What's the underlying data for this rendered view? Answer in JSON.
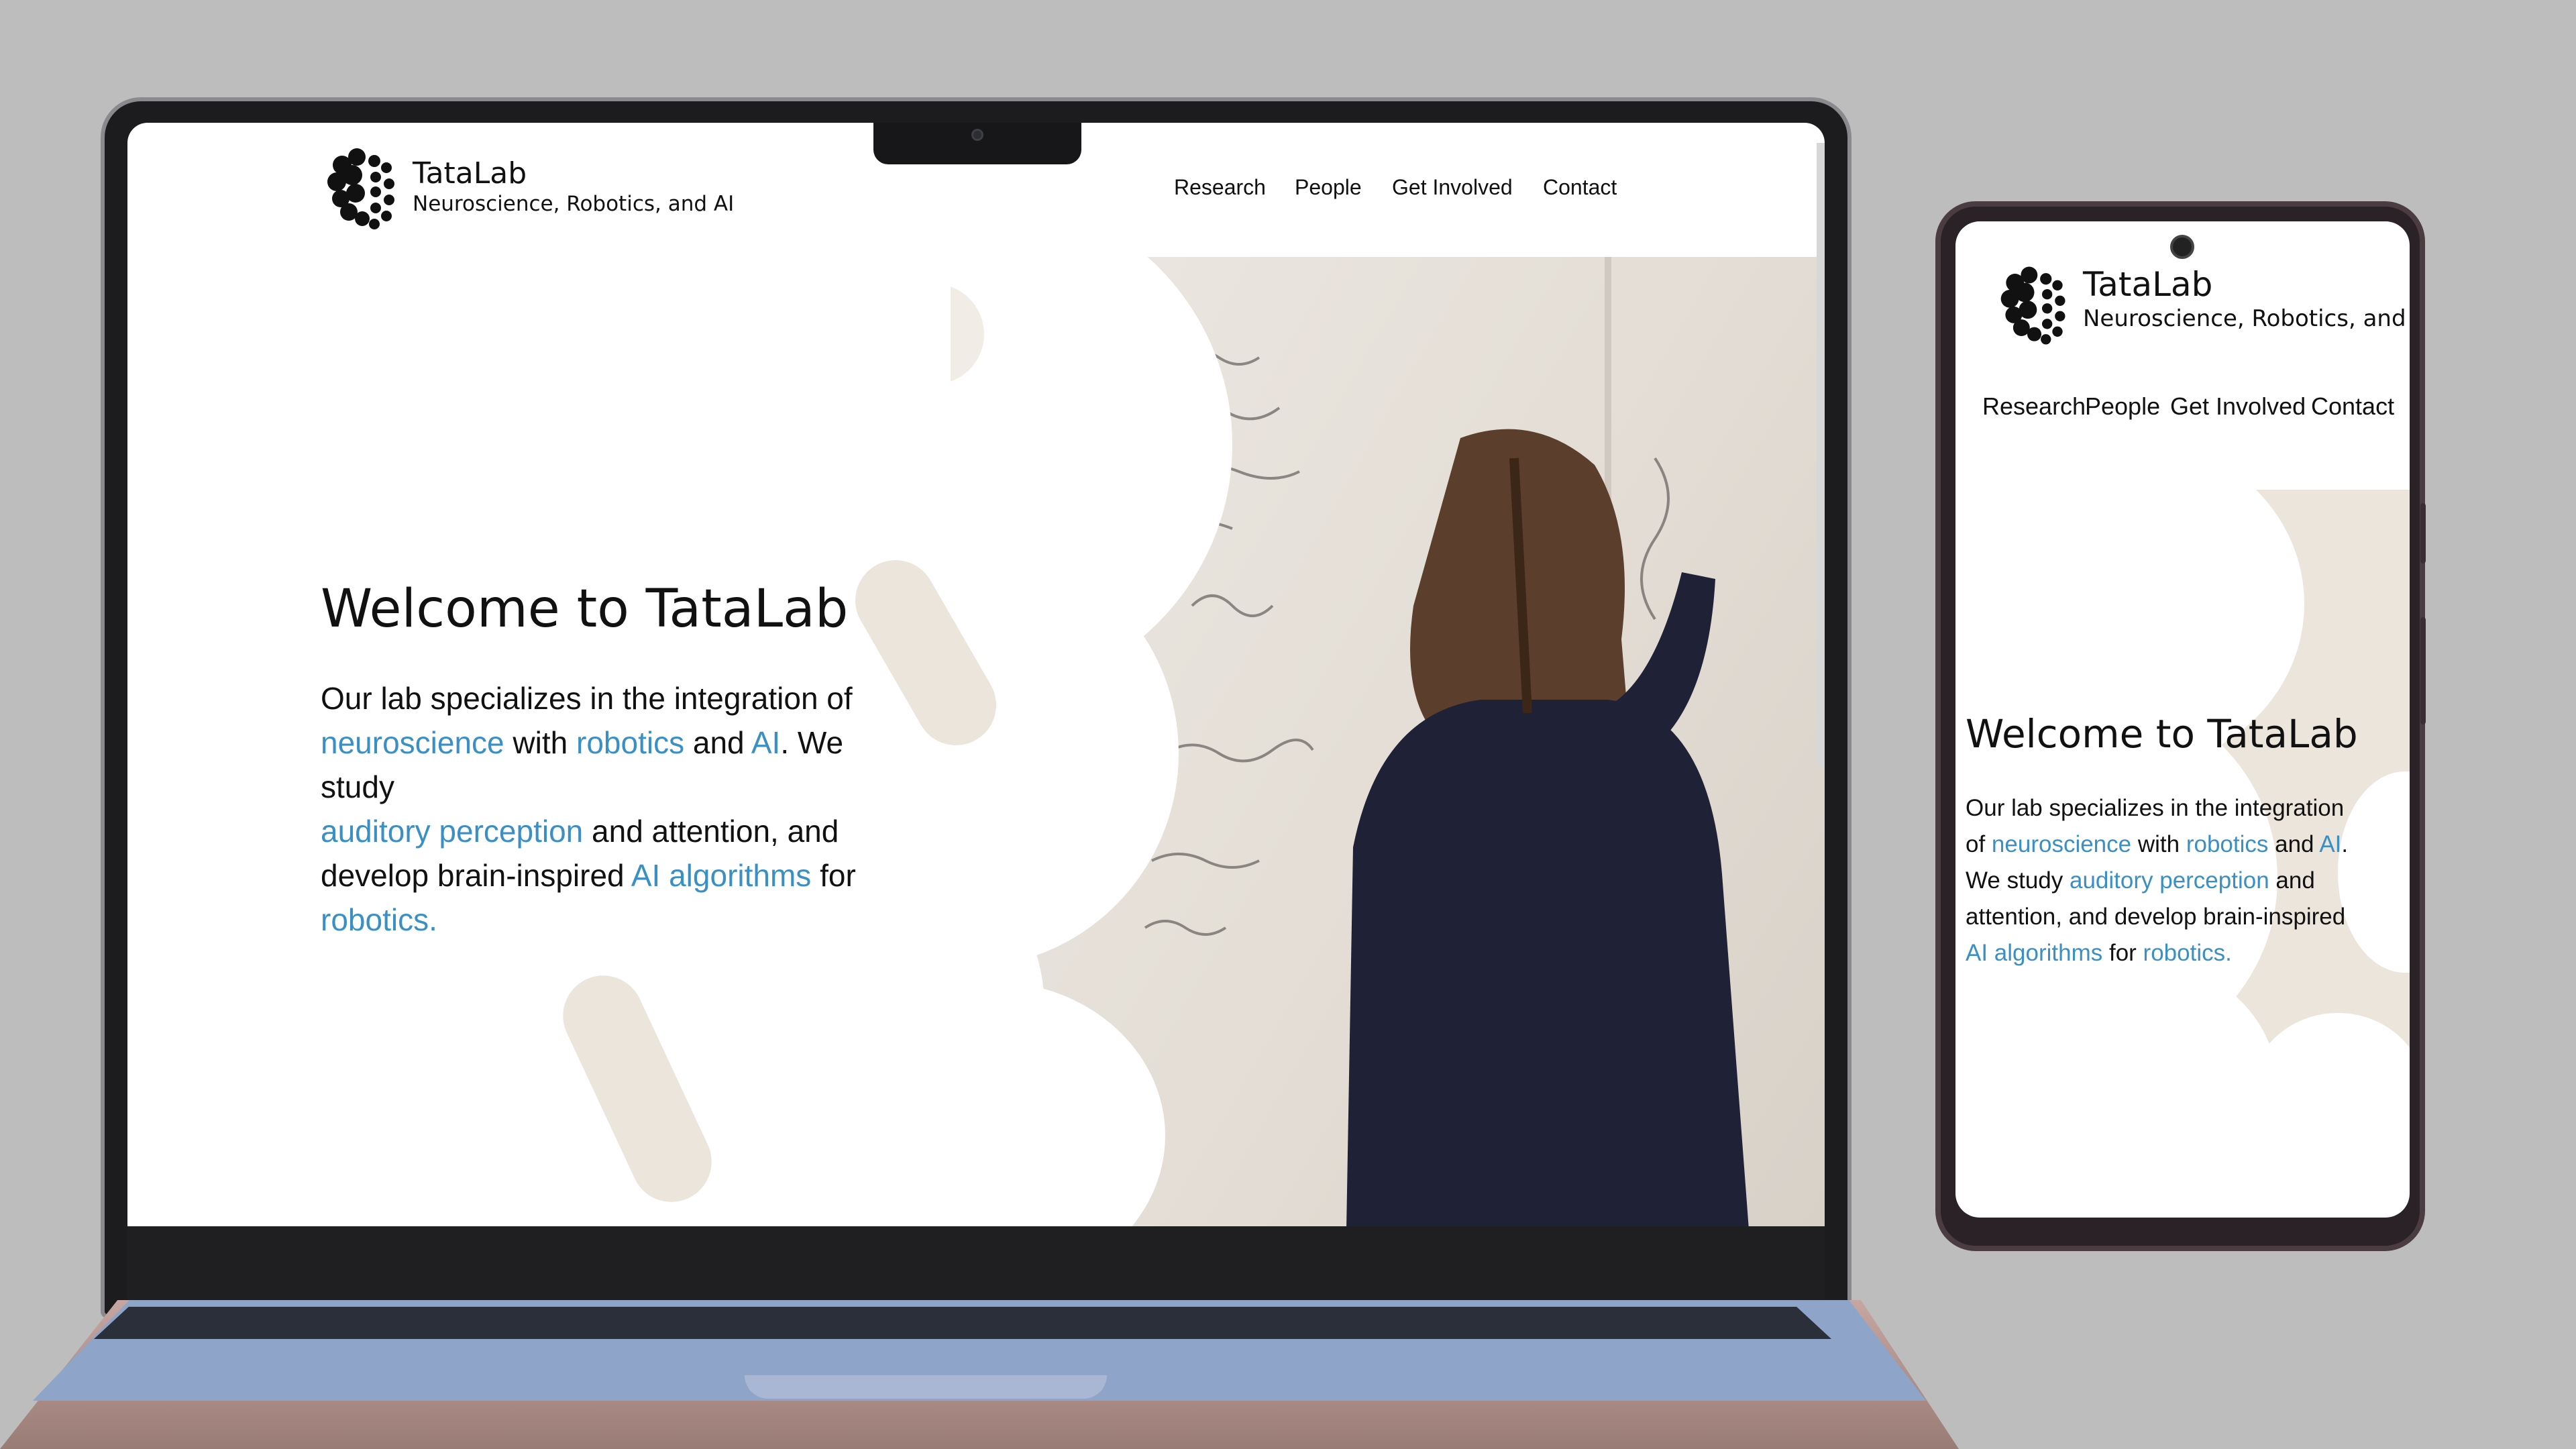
{
  "site": {
    "brand_title": "TataLab",
    "brand_subtitle": "Neuroscience, Robotics, and AI",
    "nav": [
      "Research",
      "People",
      "Get Involved",
      "Contact"
    ]
  },
  "hero": {
    "title": "Welcome to TataLab",
    "text_1": "Our lab specializes in the integration of",
    "link_neuroscience": "neuroscience",
    "text_with": " with ",
    "link_robotics": "robotics",
    "text_and": " and ",
    "link_ai": "AI",
    "text_we_study": ". We study",
    "link_auditory": "auditory perception",
    "text_attention": " and attention, and",
    "text_develop": "develop brain-inspired ",
    "link_ai_algorithms": "AI algorithms",
    "text_for": " for",
    "link_robotics_end": "robotics.",
    "phone_text_1": "Our lab specializes in the integration",
    "phone_text_of": "of ",
    "phone_text_period": ".",
    "phone_text_we_study": "We study ",
    "phone_text_and_after": " and",
    "phone_text_attention": "attention, and develop brain-inspired",
    "phone_text_for": " for "
  },
  "colors": {
    "accent": "#3a8fc4",
    "page_background": "#bdbdbd"
  },
  "icons": {
    "logo": "brain-logo-icon",
    "camera": "camera-icon"
  }
}
